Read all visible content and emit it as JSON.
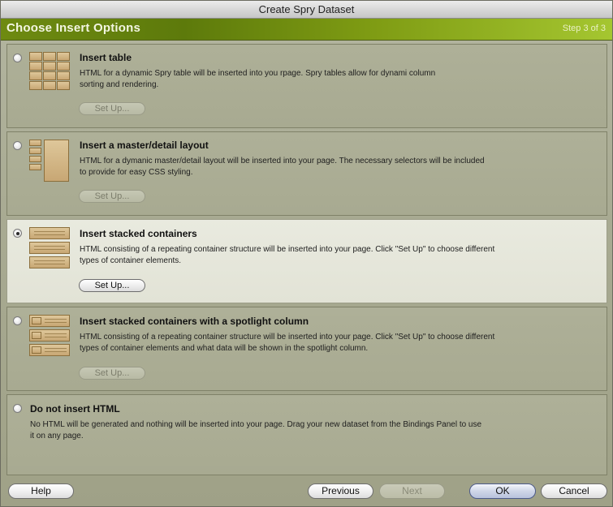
{
  "window": {
    "title": "Create Spry Dataset"
  },
  "header": {
    "title": "Choose Insert Options",
    "step": "Step 3 of 3"
  },
  "options": [
    {
      "title": "Insert table",
      "desc1": "HTML for a dynamic Spry table will be inserted into you rpage. Spry tables allow for dynami column",
      "desc2": "sorting and rendering.",
      "button": "Set Up..."
    },
    {
      "title": "Insert a master/detail layout",
      "desc1": "HTML for a dymanic master/detail layout will be inserted into your page. The necessary selectors will be included",
      "desc2": "to provide for easy CSS styling.",
      "button": "Set Up..."
    },
    {
      "title": "Insert stacked containers",
      "desc1": "HTML consisting of a repeating container structure will be inserted into your page. Click \"Set Up\" to choose different",
      "desc2": "types of container elements.",
      "button": "Set Up..."
    },
    {
      "title": "Insert stacked containers with a spotlight column",
      "desc1": "HTML consisting of a repeating container structure will be inserted into your page. Click \"Set Up\" to choose different",
      "desc2": "types of container elements and what data will be shown in the spotlight column.",
      "button": "Set Up..."
    },
    {
      "title": "Do not insert HTML",
      "desc1": "No HTML will be generated and nothing will be inserted into your page. Drag your new dataset from the Bindings Panel to use",
      "desc2": "it on any page."
    }
  ],
  "selected_option": "Insert stacked containers",
  "footer": {
    "help": "Help",
    "previous": "Previous",
    "next": "Next",
    "ok": "OK",
    "cancel": "Cancel"
  },
  "icons": {
    "insert_table": "table-grid-icon",
    "master_detail": "master-detail-icon",
    "stacked": "stacked-containers-icon",
    "spotlight": "spotlight-containers-icon"
  },
  "colors": {
    "header_green": "#6e8a11",
    "selected_panel": "#e9eadf",
    "panel": "#aeb098",
    "icon_tan": "#d4b886"
  }
}
